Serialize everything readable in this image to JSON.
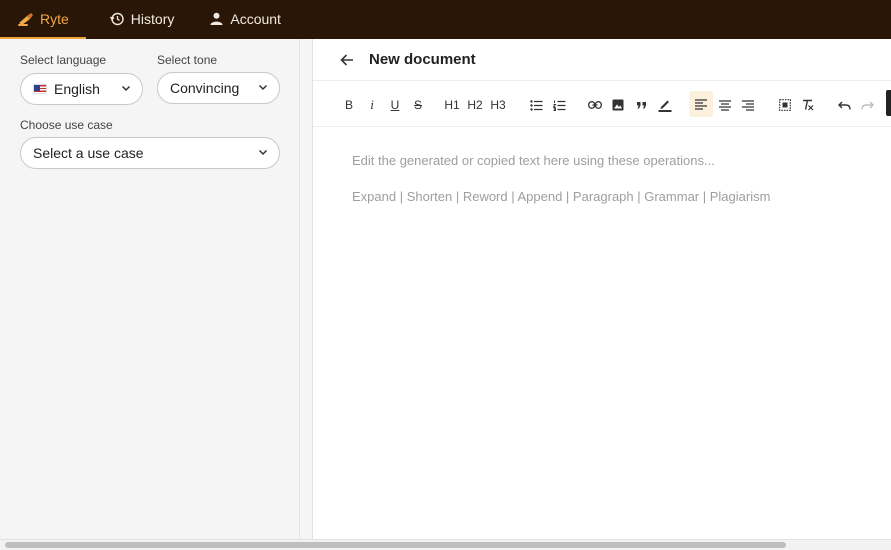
{
  "nav": {
    "brand": "Ryte",
    "history": "History",
    "account": "Account",
    "accent_color": "#e8a33c",
    "bg_color": "#2a1606"
  },
  "sidebar": {
    "language_label": "Select language",
    "language_value": "English",
    "language_flag_icon": "us-flag-icon",
    "tone_label": "Select tone",
    "tone_value": "Convincing",
    "usecase_label": "Choose use case",
    "usecase_value": "Select a use case"
  },
  "editor": {
    "title": "New document",
    "toolbar": {
      "bold": "B",
      "italic": "i",
      "underline": "U",
      "strike": "S",
      "h1": "H1",
      "h2": "H2",
      "h3": "H3"
    },
    "placeholder_line1": "Edit the generated or copied text here using these operations...",
    "placeholder_line2": "Expand | Shorten | Reword | Append | Paragraph | Grammar | Plagiarism"
  }
}
